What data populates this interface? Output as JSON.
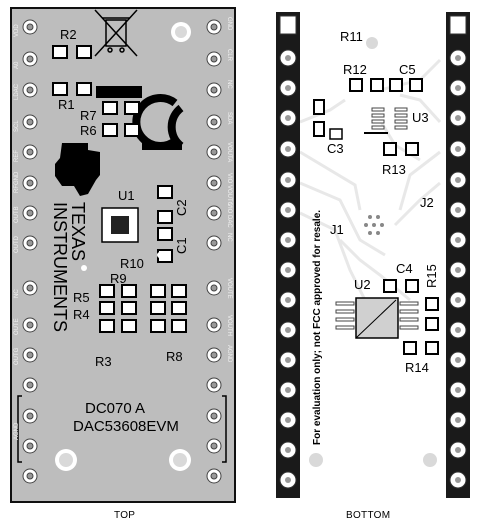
{
  "views": {
    "top_caption": "TOP",
    "bottom_caption": "BOTTOM"
  },
  "top": {
    "left_pins": [
      "VDD",
      "A0",
      "LDAC",
      "SCL",
      "REF",
      "RFGND",
      "OUTB",
      "OUTD",
      "NC",
      "OUTE",
      "OUTG",
      "AGND"
    ],
    "right_pins": [
      "GND",
      "CLR",
      "NC",
      "SDA",
      "VOUTA",
      "VIO VOUTC",
      "VIO DAC",
      "NC",
      "VOUTE",
      "VOUTH",
      "AGND"
    ],
    "refs": {
      "R2": "R2",
      "R1": "R1",
      "R7": "R7",
      "R6": "R6",
      "U1": "U1",
      "C2": "C2",
      "C1": "C1",
      "R10": "R10",
      "R9": "R9",
      "R5": "R5",
      "R4": "R4",
      "R3": "R3",
      "R8": "R8"
    },
    "brand_line1": "TEXAS",
    "brand_line2": "INSTRUMENTS",
    "board_id": "DC070 A",
    "board_name": "DAC53608EVM"
  },
  "bottom": {
    "refs": {
      "R11": "R11",
      "R12": "R12",
      "C5": "C5",
      "U3": "U3",
      "C3": "C3",
      "R13": "R13",
      "J2": "J2",
      "J1": "J1",
      "C4": "C4",
      "R15": "R15",
      "U2": "U2",
      "R14": "R14"
    },
    "fcc_notice": "For evaluation only; not FCC approved for resale."
  }
}
